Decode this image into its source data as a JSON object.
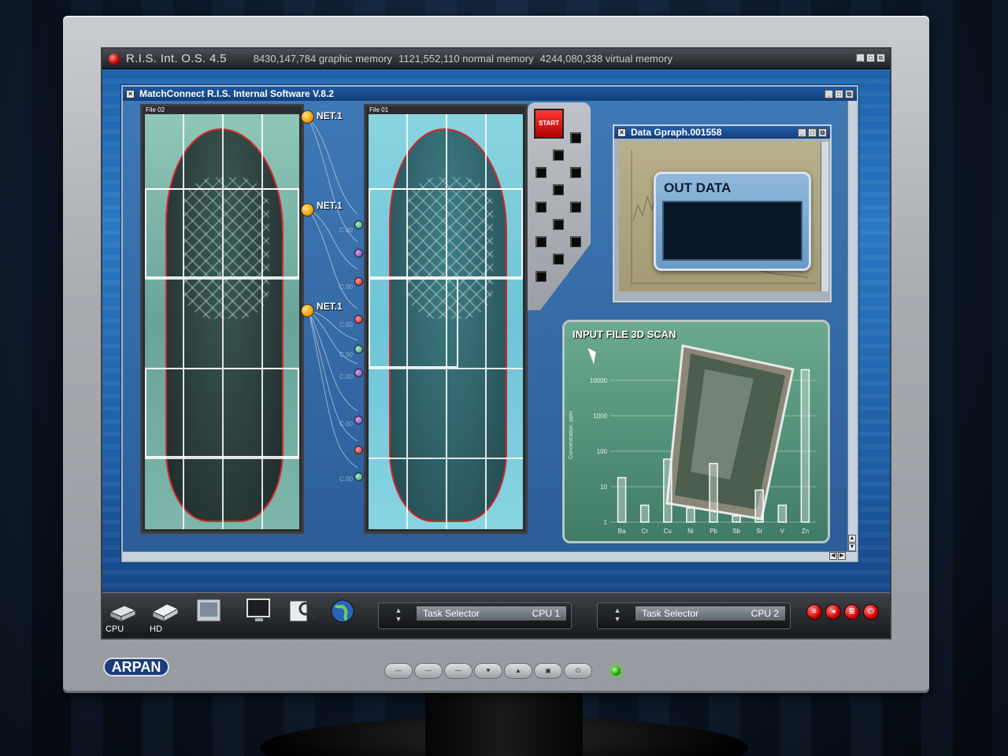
{
  "os_bar": {
    "title": "R.I.S. Int. O.S. 4.5",
    "graphic_memory": "8430,147,784 graphic memory",
    "normal_memory": "1121,552,110 normal memory",
    "virtual_memory": "4244,080,338 virtual memory"
  },
  "main_window": {
    "title": "MatchConnect  R.I.S. Internal Software V.8.2",
    "file_left": "File 02",
    "file_right": "File 01",
    "net_labels": [
      "NET.1",
      "NET.1",
      "NET.1"
    ],
    "coord_labels": [
      "C.00",
      "C.00",
      "C.00",
      "C.00",
      "C.00",
      "C.00",
      "C.00"
    ],
    "start_label": "START"
  },
  "data_window": {
    "title": "Data Gpraph.001558",
    "out_label": "OUT DATA"
  },
  "scan_window": {
    "title": "INPUT FILE 3D SCAN",
    "ylabel": "Concentration, ppm",
    "yticks": [
      "10000",
      "1000",
      "100",
      "10",
      "1"
    ],
    "categories": [
      "Ba",
      "Cr",
      "Cu",
      "Ni",
      "Pb",
      "Sb",
      "Sr",
      "V",
      "Zn"
    ],
    "values": [
      18,
      3,
      60,
      2.5,
      45,
      1.5,
      8,
      3,
      20000
    ]
  },
  "taskbar": {
    "cpu_label": "CPU",
    "hd_label": "HD",
    "selector1": {
      "label": "Task Selector",
      "cpu": "CPU 1"
    },
    "selector2": {
      "label": "Task Selector",
      "cpu": "CPU 2"
    }
  },
  "monitor": {
    "brand": "ARPAN"
  },
  "icons": [
    "cpu-icon",
    "hd-icon",
    "panel-icon",
    "monitor-icon",
    "search-icon",
    "globe-icon"
  ],
  "colors": {
    "accent": "#1b5fa8",
    "alert": "#d00000",
    "panel": "#6ba990"
  }
}
